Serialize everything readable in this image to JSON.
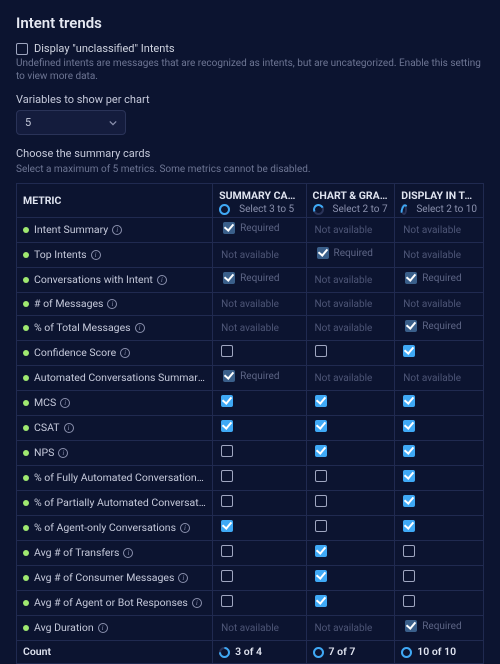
{
  "title": "Intent trends",
  "display_unclassified": {
    "label": "Display \"unclassified\" Intents",
    "hint": "Undefined intents are messages that are recognized as intents, but are uncategorized. Enable this setting to view more data."
  },
  "variables": {
    "label": "Variables to show per chart",
    "value": "5"
  },
  "cards_section": {
    "label": "Choose the summary cards",
    "hint": "Select a maximum of 5 metrics. Some metrics cannot be disabled."
  },
  "headers": {
    "metric": "METRIC",
    "col1": {
      "title": "SUMMARY CARD",
      "sub": "Select 3 to 5"
    },
    "col2": {
      "title": "CHART & GRAPH",
      "sub": "Select 2 to 7"
    },
    "col3": {
      "title": "DISPLAY IN TABLE",
      "sub": "Select 2 to 10"
    }
  },
  "cells": {
    "required": "Required",
    "na": "Not available"
  },
  "rows": [
    {
      "name": "Intent Summary",
      "c1": "req",
      "c2": "na",
      "c3": "na"
    },
    {
      "name": "Top Intents",
      "c1": "na",
      "c2": "req",
      "c3": "na"
    },
    {
      "name": "Conversations with Intent",
      "c1": "req",
      "c2": "na",
      "c3": "req"
    },
    {
      "name": "# of Messages",
      "c1": "na",
      "c2": "na",
      "c3": "na"
    },
    {
      "name": "% of Total Messages",
      "c1": "na",
      "c2": "na",
      "c3": "req"
    },
    {
      "name": "Confidence Score",
      "c1": "unchecked",
      "c2": "unchecked",
      "c3": "checked"
    },
    {
      "name": "Automated Conversations Summary",
      "c1": "req",
      "c2": "na",
      "c3": "na"
    },
    {
      "name": "MCS",
      "c1": "checked",
      "c2": "checked",
      "c3": "checked"
    },
    {
      "name": "CSAT",
      "c1": "checked",
      "c2": "checked",
      "c3": "checked"
    },
    {
      "name": "NPS",
      "c1": "unchecked",
      "c2": "checked",
      "c3": "checked"
    },
    {
      "name": "% of Fully Automated Conversations",
      "c1": "unchecked",
      "c2": "unchecked",
      "c3": "checked"
    },
    {
      "name": "% of Partially Automated Conversations",
      "c1": "unchecked",
      "c2": "unchecked",
      "c3": "checked"
    },
    {
      "name": "% of Agent-only Conversations",
      "c1": "checked",
      "c2": "unchecked",
      "c3": "checked"
    },
    {
      "name": "Avg # of Transfers",
      "c1": "unchecked",
      "c2": "checked",
      "c3": "unchecked"
    },
    {
      "name": "Avg # of Consumer Messages",
      "c1": "unchecked",
      "c2": "checked",
      "c3": "unchecked"
    },
    {
      "name": "Avg # of Agent or Bot Responses",
      "c1": "unchecked",
      "c2": "checked",
      "c3": "unchecked"
    },
    {
      "name": "Avg Duration",
      "c1": "na",
      "c2": "na",
      "c3": "req"
    }
  ],
  "footer": {
    "label": "Count",
    "c1": "3 of 4",
    "c2": "7 of 7",
    "c3": "10 of 10"
  }
}
